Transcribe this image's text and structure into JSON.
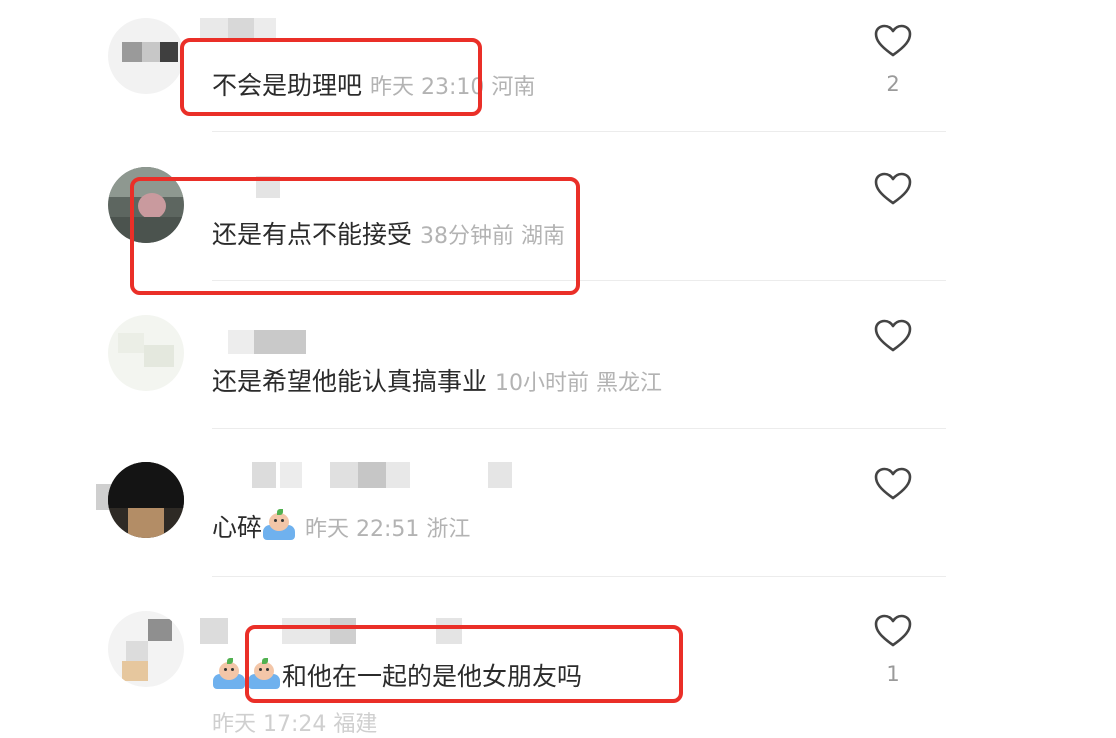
{
  "comments": [
    {
      "text": "不会是助理吧",
      "time": "昨天 23:10",
      "location": "河南",
      "likes": "2"
    },
    {
      "text": "还是有点不能接受",
      "time": "38分钟前",
      "location": "湖南",
      "likes": ""
    },
    {
      "text": "还是希望他能认真搞事业",
      "time": "10小时前",
      "location": "黑龙江",
      "likes": ""
    },
    {
      "text": "心碎",
      "time": "昨天 22:51",
      "location": "浙江",
      "likes": ""
    },
    {
      "text": "和他在一起的是他女朋友吗",
      "time": "",
      "location": "",
      "likes": "1"
    }
  ],
  "partial_meta": "昨天 17:24 福建",
  "icons": {
    "like": "heart-outline-icon",
    "emoji": "crying-bath-emoji-icon"
  },
  "colors": {
    "highlight": "#ea2f28",
    "text": "#2b2b2b",
    "meta": "#b3b3b3"
  }
}
